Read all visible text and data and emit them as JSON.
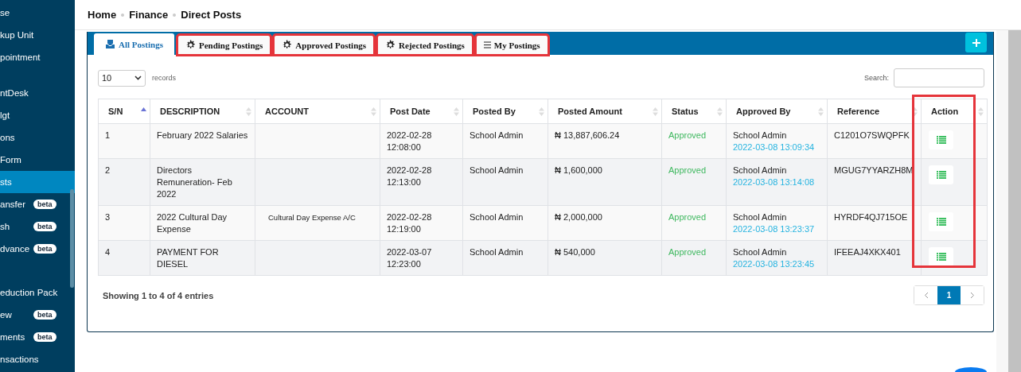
{
  "sidebar": {
    "items": [
      {
        "label": "se",
        "kind": "item",
        "selected": false
      },
      {
        "label": "kup Unit",
        "kind": "item",
        "selected": false
      },
      {
        "label": "pointment",
        "kind": "item",
        "selected": false
      },
      {
        "label": "ntDesk",
        "kind": "spaced",
        "selected": false
      },
      {
        "label": "lgt",
        "kind": "item",
        "selected": false
      },
      {
        "label": "ons",
        "kind": "item",
        "selected": false
      },
      {
        "label": "Form",
        "kind": "item",
        "selected": false
      },
      {
        "label": "sts",
        "kind": "item",
        "selected": true
      },
      {
        "label": "ansfer",
        "kind": "item",
        "selected": false,
        "badge": "beta"
      },
      {
        "label": "sh",
        "kind": "item",
        "selected": false,
        "badge": "beta"
      },
      {
        "label": "dvance",
        "kind": "item",
        "selected": false,
        "badge": "beta"
      },
      {
        "label": "eduction Pack",
        "kind": "spaced_more",
        "selected": false
      },
      {
        "label": "ew",
        "kind": "item",
        "selected": false,
        "badge": "beta"
      },
      {
        "label": "ments",
        "kind": "item",
        "selected": false,
        "badge": "beta"
      },
      {
        "label": "nsactions",
        "kind": "item",
        "selected": false
      }
    ]
  },
  "breadcrumb": [
    "Home",
    "Finance",
    "Direct Posts"
  ],
  "tabs": [
    {
      "label": "All Postings",
      "selected": true,
      "highlighted": false
    },
    {
      "label": "Pending Postings",
      "selected": false,
      "highlighted": true
    },
    {
      "label": "Approved Postings",
      "selected": false,
      "highlighted": true
    },
    {
      "label": "Rejected Postings",
      "selected": false,
      "highlighted": true
    },
    {
      "label": "My Postings",
      "selected": false,
      "highlighted": true
    }
  ],
  "length_select": {
    "value": "10",
    "label": "records"
  },
  "search": {
    "label": "Search:"
  },
  "table": {
    "columns": [
      {
        "label": "S/N",
        "sorted": true
      },
      {
        "label": "DESCRIPTION",
        "sorted": false
      },
      {
        "label": "ACCOUNT",
        "sorted": false
      },
      {
        "label": "Post Date",
        "sorted": false
      },
      {
        "label": "Posted By",
        "sorted": false
      },
      {
        "label": "Posted Amount",
        "sorted": false
      },
      {
        "label": "Status",
        "sorted": false
      },
      {
        "label": "Approved By",
        "sorted": false
      },
      {
        "label": "Reference",
        "sorted": false
      },
      {
        "label": "Action",
        "sorted": false,
        "highlighted": true
      }
    ],
    "rows": [
      {
        "sn": "1",
        "description": "February 2022 Salaries",
        "post_date": "2022-02-28 12:08:00",
        "posted_by": "School Admin",
        "amount": "₦ 13,887,606.24",
        "status": "Approved",
        "approved_by": "School Admin",
        "approved_at": "2022-03-08 13:09:34",
        "reference": "C1201O7SWQPFK"
      },
      {
        "sn": "2",
        "description": "Directors Remuneration- Feb 2022",
        "post_date": "2022-02-28 12:13:00",
        "posted_by": "School Admin",
        "amount": "₦ 1,600,000",
        "status": "Approved",
        "approved_by": "School Admin",
        "approved_at": "2022-03-08 13:14:08",
        "reference": "MGUG7YYARZH8M"
      },
      {
        "sn": "3",
        "description": "2022 Cultural Day Expense",
        "account": "Cultural Day Expense A/C",
        "post_date": "2022-02-28 12:19:00",
        "posted_by": "School Admin",
        "amount": "₦ 2,000,000",
        "status": "Approved",
        "approved_by": "School Admin",
        "approved_at": "2022-03-08 13:23:37",
        "reference": "HYRDF4QJ715OE"
      },
      {
        "sn": "4",
        "description": "PAYMENT FOR DIESEL",
        "post_date": "2022-03-07 12:23:00",
        "posted_by": "School Admin",
        "amount": "₦ 540,000",
        "status": "Approved",
        "approved_by": "School Admin",
        "approved_at": "2022-03-08 13:23:45",
        "reference": "IFEEAJ4XKX401"
      }
    ]
  },
  "info": "Showing 1 to 4 of 4 entries",
  "pagination": {
    "pages": [
      {
        "label": "1",
        "selected": true
      }
    ]
  }
}
